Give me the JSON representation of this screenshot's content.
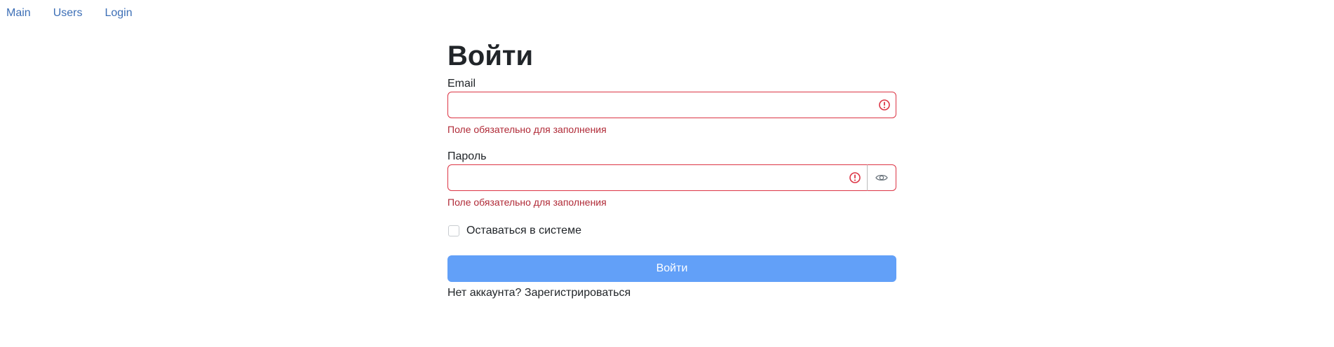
{
  "nav": {
    "items": [
      {
        "label": "Main"
      },
      {
        "label": "Users"
      },
      {
        "label": "Login"
      }
    ]
  },
  "form": {
    "title": "Войти",
    "email": {
      "label": "Email",
      "value": "",
      "error": "Поле обязательно для заполнения"
    },
    "password": {
      "label": "Пароль",
      "value": "",
      "error": "Поле обязательно для заполнения"
    },
    "remember_label": "Оставаться в системе",
    "remember_checked": false,
    "submit_label": "Войти",
    "register_prompt": "Нет аккаунта?",
    "register_link": "Зарегистрироваться"
  },
  "colors": {
    "link": "#3d6fb6",
    "error": "#dc3545",
    "primary": "#62a0f8"
  },
  "icons": {
    "error": "exclamation-circle-icon",
    "toggle_password": "eye-icon"
  }
}
